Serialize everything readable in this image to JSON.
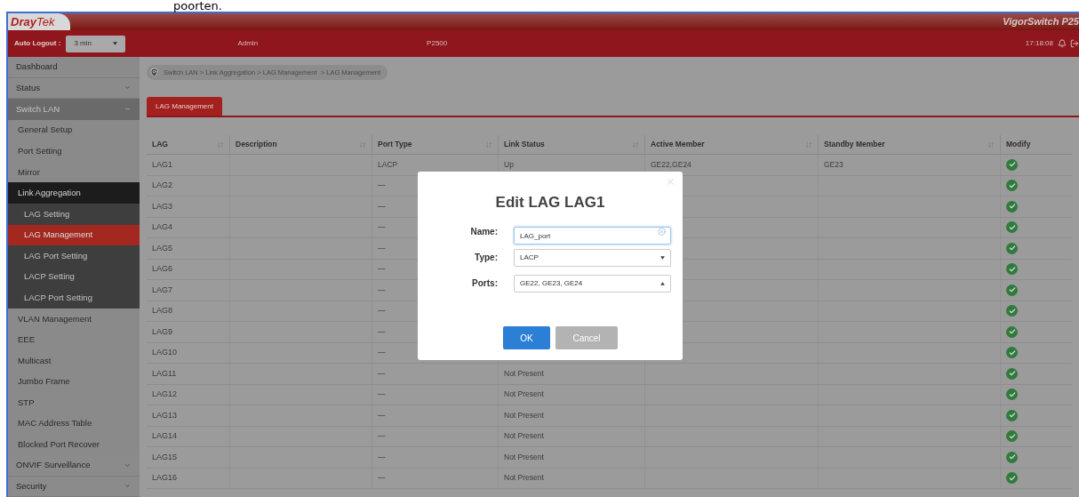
{
  "document_text": "poorten.",
  "header": {
    "logo": "**Dray**Tek",
    "product": "VigorSwitch P25",
    "auto_logout_label": "Auto Logout :",
    "auto_logout_value": "3 min",
    "user": "Admin",
    "model": "P2500",
    "time": "17:18:08"
  },
  "sidebar": {
    "items": [
      {
        "label": "Dashboard",
        "selected": false
      },
      {
        "label": "Status",
        "selected": false,
        "expanded": false
      },
      {
        "label": "Switch LAN",
        "selected": false,
        "expanded": true,
        "children": [
          {
            "label": "General Setup",
            "selected": false
          },
          {
            "label": "Port Setting",
            "selected": false
          },
          {
            "label": "Mirror",
            "selected": false
          },
          {
            "label": "Link Aggregation",
            "selected": false,
            "expanded": true,
            "children": [
              {
                "label": "LAG Setting",
                "selected": false
              },
              {
                "label": "LAG Management",
                "selected": true
              },
              {
                "label": "LAG Port Setting",
                "selected": false
              },
              {
                "label": "LACP Setting",
                "selected": false
              },
              {
                "label": "LACP Port Setting",
                "selected": false
              }
            ]
          },
          {
            "label": "VLAN Management",
            "selected": false
          },
          {
            "label": "EEE",
            "selected": false
          },
          {
            "label": "Multicast",
            "selected": false
          },
          {
            "label": "Jumbo Frame",
            "selected": false
          },
          {
            "label": "STP",
            "selected": false
          },
          {
            "label": "MAC Address Table",
            "selected": false
          },
          {
            "label": "Blocked Port Recover",
            "selected": false
          }
        ]
      },
      {
        "label": "ONVIF Surveillance",
        "selected": false,
        "expanded": false
      },
      {
        "label": "Security",
        "selected": false,
        "expanded": false
      }
    ]
  },
  "breadcrumb": "Switch LAN > Link Aggregation > LAG Management  > LAG Management",
  "tabs": [
    {
      "label": "LAG Management",
      "selected": true
    }
  ],
  "table": {
    "columns": [
      {
        "label": "LAG",
        "sortable": true
      },
      {
        "label": "Description",
        "sortable": true
      },
      {
        "label": "Port Type",
        "sortable": true
      },
      {
        "label": "Link Status",
        "sortable": true
      },
      {
        "label": "Active Member",
        "sortable": true
      },
      {
        "label": "Standby Member",
        "sortable": true
      },
      {
        "label": "Modify",
        "sortable": false
      }
    ],
    "rows": [
      {
        "lag": "LAG1",
        "port_type": "LACP",
        "link_status": "Up",
        "active_member": "GE22,GE24",
        "standby_member": "GE23"
      },
      {
        "lag": "LAG2",
        "port_type": "—"
      },
      {
        "lag": "LAG3",
        "port_type": "—"
      },
      {
        "lag": "LAG4",
        "port_type": "—"
      },
      {
        "lag": "LAG5",
        "port_type": "—"
      },
      {
        "lag": "LAG6",
        "port_type": "—"
      },
      {
        "lag": "LAG7",
        "port_type": "—"
      },
      {
        "lag": "LAG8",
        "port_type": "—"
      },
      {
        "lag": "LAG9",
        "port_type": "—"
      },
      {
        "lag": "LAG10",
        "port_type": "—"
      },
      {
        "lag": "LAG11",
        "port_type": "—",
        "link_status": "Not Present"
      },
      {
        "lag": "LAG12",
        "port_type": "—",
        "link_status": "Not Present"
      },
      {
        "lag": "LAG13",
        "port_type": "—",
        "link_status": "Not Present"
      },
      {
        "lag": "LAG14",
        "port_type": "—",
        "link_status": "Not Present"
      },
      {
        "lag": "LAG15",
        "port_type": "—",
        "link_status": "Not Present"
      },
      {
        "lag": "LAG16",
        "port_type": "—",
        "link_status": "Not Present"
      }
    ]
  },
  "dialog": {
    "title": "Edit LAG LAG1",
    "fields": [
      {
        "kind": "text",
        "label": "Name:",
        "value": "LAG_port"
      },
      {
        "kind": "select",
        "label": "Type:",
        "value": "LACP",
        "expanded": false
      },
      {
        "kind": "select",
        "label": "Ports:",
        "value": "GE22, GE23, GE24",
        "expanded": true
      }
    ],
    "buttons": [
      {
        "label": "OK",
        "kind": "primary"
      },
      {
        "label": "Cancel",
        "kind": "secondary"
      }
    ]
  }
}
